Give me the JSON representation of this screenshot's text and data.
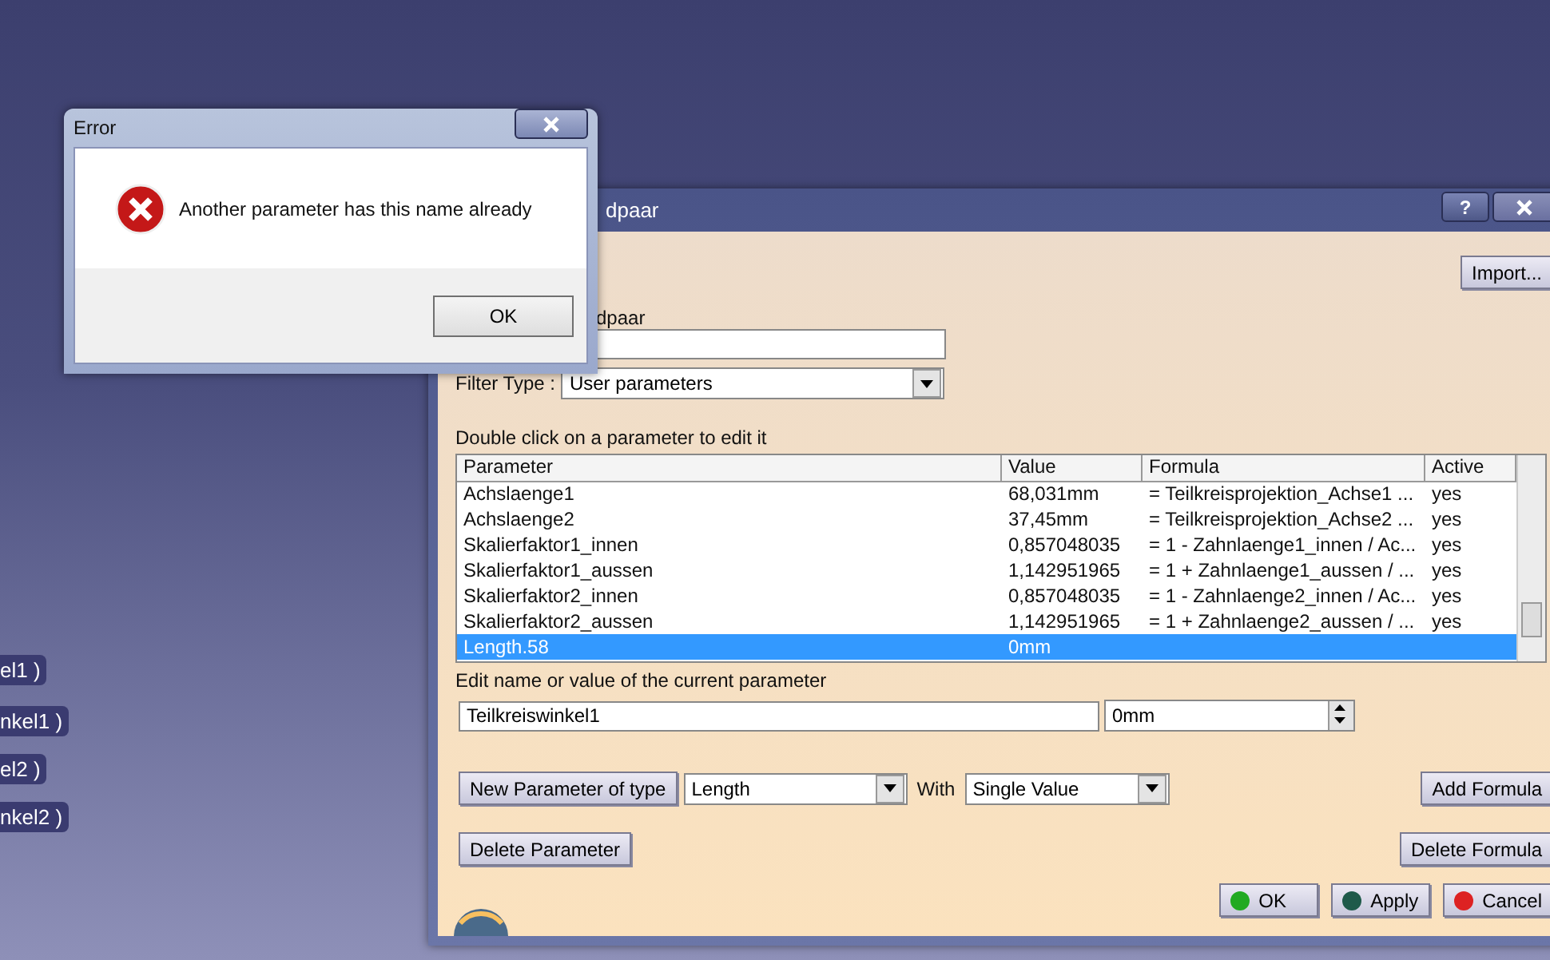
{
  "desktop_labels": [
    {
      "text": "el1 )"
    },
    {
      "text": "nkel1 )"
    },
    {
      "text": "el2 )"
    },
    {
      "text": "nkel2 )"
    }
  ],
  "parameters_dialog": {
    "title": "dpaar",
    "help_button": "?",
    "import_button": "Import...",
    "name_label": "dpaar",
    "filter_label": "Filter Type :",
    "filter_value": "User parameters",
    "list_hint": "Double click on a parameter to edit it",
    "table": {
      "columns": [
        "Parameter",
        "Value",
        "Formula",
        "Active"
      ],
      "rows": [
        {
          "cells": [
            "Achslaenge1",
            "68,031mm",
            "= Teilkreisprojektion_Achse1 ...",
            "yes"
          ],
          "selected": false
        },
        {
          "cells": [
            "Achslaenge2",
            "37,45mm",
            "= Teilkreisprojektion_Achse2 ...",
            "yes"
          ],
          "selected": false
        },
        {
          "cells": [
            "Skalierfaktor1_innen",
            "0,857048035",
            "= 1 - Zahnlaenge1_innen / Ac...",
            "yes"
          ],
          "selected": false
        },
        {
          "cells": [
            "Skalierfaktor1_aussen",
            "1,142951965",
            "= 1 + Zahnlaenge1_aussen / ...",
            "yes"
          ],
          "selected": false
        },
        {
          "cells": [
            "Skalierfaktor2_innen",
            "0,857048035",
            "= 1 - Zahnlaenge2_innen / Ac...",
            "yes"
          ],
          "selected": false
        },
        {
          "cells": [
            "Skalierfaktor2_aussen",
            "1,142951965",
            "= 1 + Zahnlaenge2_aussen / ...",
            "yes"
          ],
          "selected": false
        },
        {
          "cells": [
            "Length.58",
            "0mm",
            "",
            ""
          ],
          "selected": true
        }
      ]
    },
    "edit_label": "Edit name or value of the current parameter",
    "name_value": "Teilkreiswinkel1",
    "value_value": "0mm",
    "new_parameter_button": "New Parameter of type",
    "type_value": "Length",
    "with_label": "With",
    "with_value": "Single Value",
    "add_formula_button": "Add Formula",
    "delete_parameter_button": "Delete Parameter",
    "delete_formula_button": "Delete Formula",
    "buttons": [
      {
        "label": "OK",
        "color": "#22aa22"
      },
      {
        "label": "Apply",
        "color": "#1f5a4a"
      },
      {
        "label": "Cancel",
        "color": "#dd2222"
      }
    ]
  },
  "error_dialog": {
    "title": "Error",
    "message": "Another parameter has this name already",
    "ok_button": "OK"
  }
}
